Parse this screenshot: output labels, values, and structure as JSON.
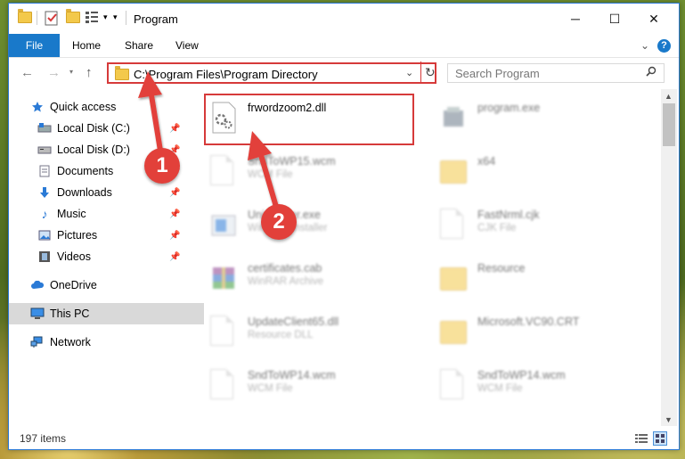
{
  "window": {
    "title": "Program",
    "controls": {
      "minimize": "─",
      "maximize": "☐",
      "close": "✕"
    }
  },
  "ribbon": {
    "tabs": [
      "File",
      "Home",
      "Share",
      "View"
    ],
    "expand": "⌄",
    "help": "?"
  },
  "address": {
    "path": "C:\\Program Files\\Program Directory",
    "search_placeholder": "Search Program"
  },
  "nav": {
    "items": [
      {
        "label": "Quick access",
        "icon": "star-icon",
        "pinned": false
      },
      {
        "label": "Local Disk (C:)",
        "icon": "drive-icon",
        "pinned": true
      },
      {
        "label": "Local Disk (D:)",
        "icon": "drive-icon",
        "pinned": true
      },
      {
        "label": "Documents",
        "icon": "documents-icon",
        "pinned": true
      },
      {
        "label": "Downloads",
        "icon": "download-icon",
        "pinned": true
      },
      {
        "label": "Music",
        "icon": "music-icon",
        "pinned": true
      },
      {
        "label": "Pictures",
        "icon": "pictures-icon",
        "pinned": true
      },
      {
        "label": "Videos",
        "icon": "videos-icon",
        "pinned": true
      },
      {
        "label": "OneDrive",
        "icon": "cloud-icon",
        "pinned": false
      },
      {
        "label": "This PC",
        "icon": "computer-icon",
        "pinned": false,
        "selected": true
      },
      {
        "label": "Network",
        "icon": "network-icon",
        "pinned": false
      }
    ]
  },
  "files": [
    {
      "name": "frwordzoom2.dll",
      "desc": "",
      "type": "dll",
      "highlighted": true
    },
    {
      "name": "program.exe",
      "desc": "",
      "type": "exe"
    },
    {
      "name": "SndToWP15.wcm",
      "desc": "WCM File",
      "type": "doc"
    },
    {
      "name": "x64",
      "desc": "",
      "type": "folder"
    },
    {
      "name": "Uninstaller.exe",
      "desc": "Windows installer",
      "type": "installer"
    },
    {
      "name": "FastNrml.cjk",
      "desc": "CJK File",
      "type": "doc"
    },
    {
      "name": "certificates.cab",
      "desc": "WinRAR Archive",
      "type": "archive"
    },
    {
      "name": "Resource",
      "desc": "",
      "type": "folder"
    },
    {
      "name": "UpdateClient65.dll",
      "desc": "Resource DLL",
      "type": "dll"
    },
    {
      "name": "Microsoft.VC90.CRT",
      "desc": "",
      "type": "folder"
    },
    {
      "name": "SndToWP14.wcm",
      "desc": "WCM File",
      "type": "doc"
    },
    {
      "name": "SndToWP14.wcm",
      "desc": "WCM File",
      "type": "doc"
    }
  ],
  "status": {
    "count": "197 items"
  },
  "callouts": {
    "one": "1",
    "two": "2"
  },
  "colors": {
    "accent": "#1979ca",
    "highlight": "#d63a3a",
    "badge": "#e2403a",
    "folder": "#f3c94b"
  }
}
